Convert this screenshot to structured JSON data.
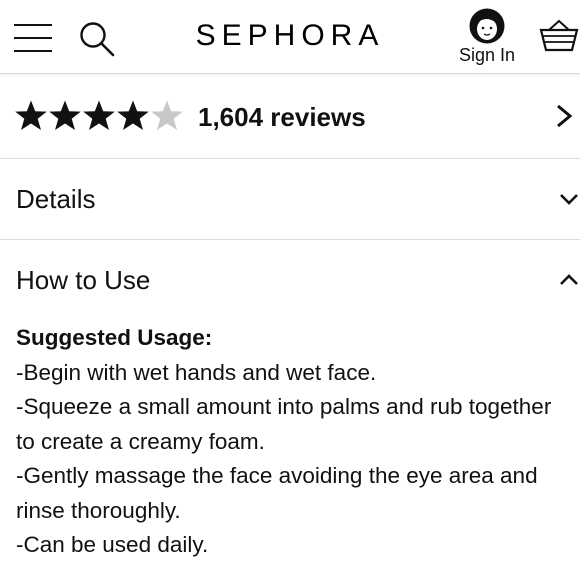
{
  "header": {
    "brand": "SEPHORA",
    "signin_label": "Sign In",
    "icons": [
      "hamburger-menu-icon",
      "search-icon",
      "avatar-icon",
      "basket-icon"
    ]
  },
  "rating": {
    "stars_filled": 4,
    "stars_total": 5,
    "reviews_label": "1,604 reviews",
    "filled_color": "#111111",
    "empty_color": "#c8c8c8"
  },
  "accordion": {
    "details_label": "Details",
    "how_to_use_label": "How to Use"
  },
  "how_to_use": {
    "subhead": "Suggested Usage:",
    "lines": [
      "-Begin with wet hands and wet face.",
      "-Squeeze a small amount into palms and rub together",
      "to create a creamy foam.",
      "-Gently massage the face avoiding the eye area and",
      "rinse thoroughly.",
      "-Can be used daily."
    ]
  }
}
